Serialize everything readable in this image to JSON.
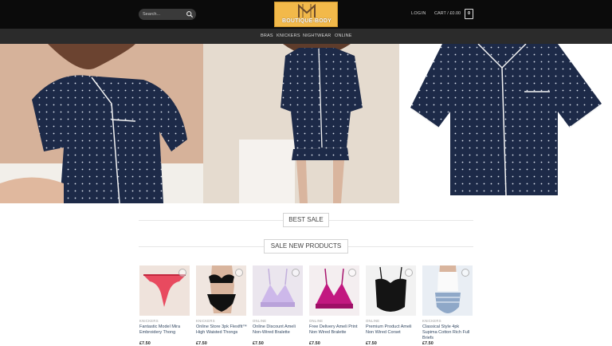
{
  "header": {
    "search_placeholder": "Search...",
    "logo_text": "BOUTIQUE-BODY",
    "login": "LOGIN",
    "cart_label": "CART / £0.00",
    "cart_count": "0"
  },
  "nav": {
    "items": [
      "BRAS",
      "KNICKERS",
      "NIGHTWEAR",
      "ONLINE"
    ]
  },
  "sections": {
    "best_sale": "BEST SALE",
    "new_products": "SALE NEW PRODUCTS"
  },
  "products": [
    {
      "category": "KNICKERS",
      "title": "Fantastic Model Mira Embroidery Thong",
      "price": "£7.50"
    },
    {
      "category": "KNICKERS",
      "title": "Online Store 3pk Flexifit™ High Waisted Thongs",
      "price": "£7.50"
    },
    {
      "category": "ONLINE",
      "title": "Online Discount Ameli Non-Wired Bralette",
      "price": "£7.50"
    },
    {
      "category": "ONLINE",
      "title": "Free Delivery Ameli Print Non Wired Bralette",
      "price": "£7.50"
    },
    {
      "category": "ONLINE",
      "title": "Premium Product Ameli Non Wired Corset",
      "price": "£7.50"
    },
    {
      "category": "KNICKERS",
      "title": "Classical Style 4pk Supima Cotton Rich Full Briefs",
      "price": "£7.50"
    }
  ],
  "colors": {
    "topbar": "#0b0b0b",
    "navbar": "#2b2b2b",
    "logo_bg": "#f2b94a",
    "pajama": "#1d2a48"
  }
}
